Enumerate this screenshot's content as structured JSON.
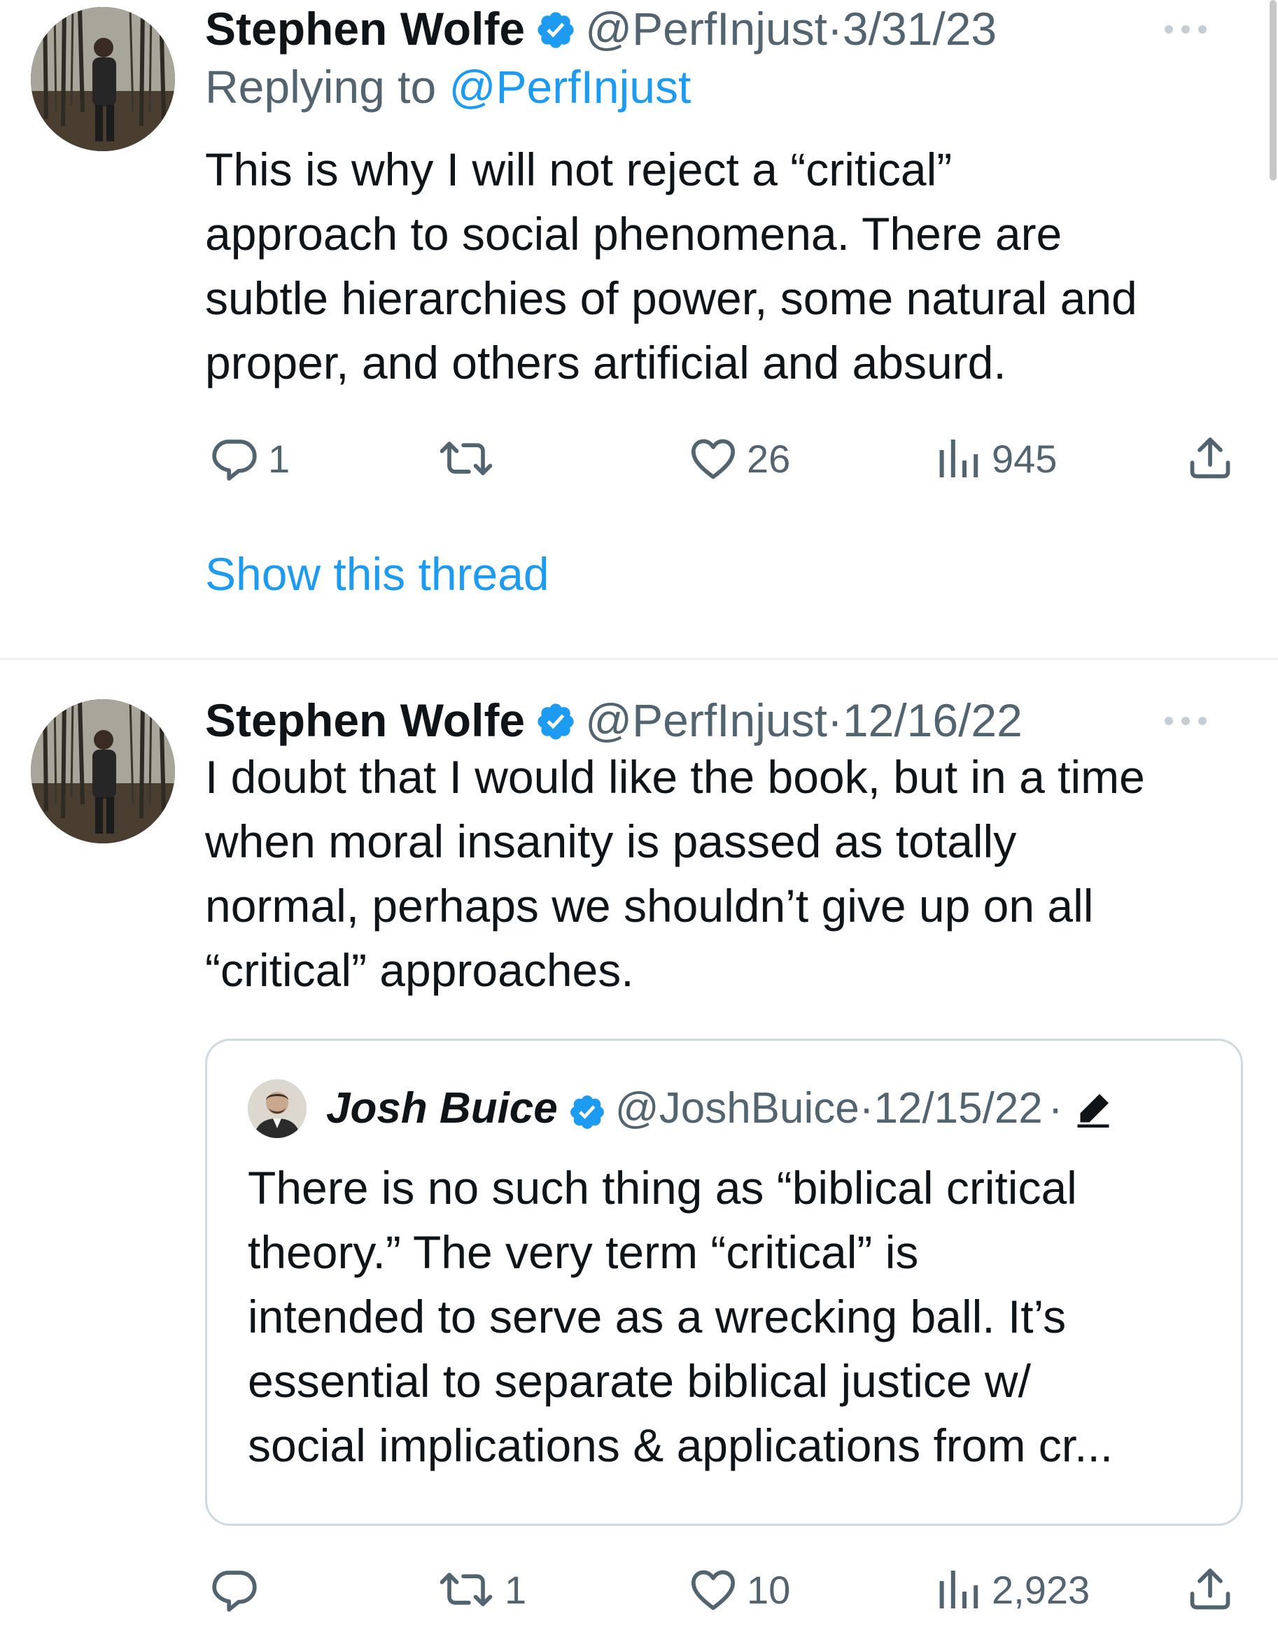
{
  "tweets": [
    {
      "author_name": "Stephen Wolfe",
      "handle": "@PerfInjust",
      "separator": "·",
      "date": "3/31/23",
      "reply_prefix": "Replying to ",
      "reply_handle": "@PerfInjust",
      "body_lines": [
        "This is why I will not reject a “critical”",
        "approach to social phenomena. There are",
        "subtle hierarchies of power, some natural and",
        "proper, and others artificial and absurd."
      ],
      "actions": {
        "replies": "1",
        "retweets": "",
        "likes": "26",
        "views": "945"
      },
      "show_thread": "Show this thread"
    },
    {
      "author_name": "Stephen Wolfe",
      "handle": "@PerfInjust",
      "separator": "·",
      "date": "12/16/22",
      "body_lines": [
        "I doubt that I would like the book, but in a time",
        "when moral insanity is passed as totally",
        "normal, perhaps we shouldn’t give up on all",
        "“critical” approaches."
      ],
      "quote": {
        "author_name": "Josh Buice",
        "handle": "@JoshBuice",
        "separator": "·",
        "date": "12/15/22",
        "trailing_separator": "·",
        "body_lines": [
          "There is no such thing as “biblical critical",
          "theory.” The very term “critical” is",
          "intended to serve as a wrecking ball. It’s",
          "essential to separate biblical justice w/",
          "social implications & applications from cr..."
        ]
      },
      "actions": {
        "replies": "",
        "retweets": "1",
        "likes": "10",
        "views": "2,923"
      }
    }
  ],
  "colors": {
    "text": "#0f1419",
    "muted": "#536471",
    "link": "#1d9bf0",
    "verified": "#1d9bf0",
    "border": "#cfd9de"
  },
  "icons": [
    "verified-badge-icon",
    "more-icon",
    "reply-icon",
    "retweet-icon",
    "like-icon",
    "views-icon",
    "share-icon",
    "edit-pencil-icon"
  ]
}
